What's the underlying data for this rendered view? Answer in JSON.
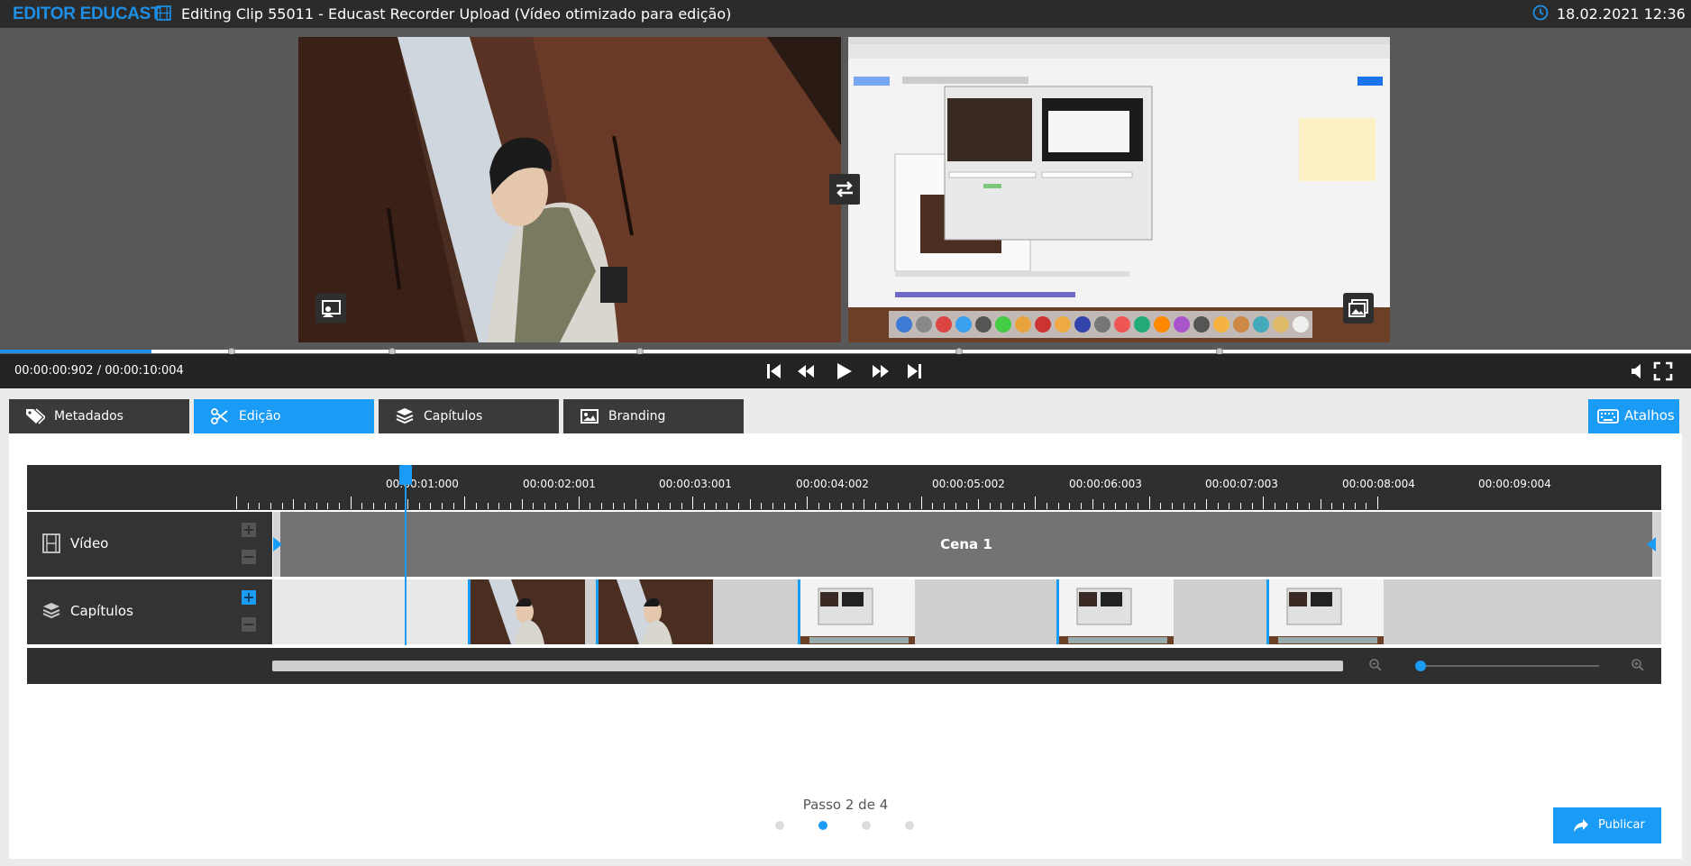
{
  "header": {
    "brand": "EDITOR EDUCAST",
    "clip_title": "Editing Clip 55011 - Educast Recorder Upload  (Vídeo otimizado para edição)",
    "datetime": "18.02.2021 12:36"
  },
  "player": {
    "timecode": "00:00:00:902 / 00:00:10:004",
    "progress_fraction": 0.09
  },
  "tabs": [
    {
      "label": "Metadados",
      "icon": "tag-icon",
      "active": false
    },
    {
      "label": "Edição",
      "icon": "scissors-icon",
      "active": true
    },
    {
      "label": "Capítulos",
      "icon": "layers-icon",
      "active": false
    },
    {
      "label": "Branding",
      "icon": "image-icon",
      "active": false
    }
  ],
  "atalhos_label": "Atalhos",
  "timeline": {
    "ruler_labels": [
      "00:00:01:000",
      "00:00:02:001",
      "00:00:03:001",
      "00:00:04:002",
      "00:00:05:002",
      "00:00:06:003",
      "00:00:07:003",
      "00:00:08:004",
      "00:00:09:004"
    ],
    "tracks": {
      "video": "Vídeo",
      "chapters": "Capítulos"
    },
    "scene_label": "Cena 1"
  },
  "stepper": {
    "text": "Passo 2 de 4",
    "current": 2,
    "total": 4
  },
  "publish_label": "Publicar",
  "colors": {
    "accent": "#1a9bf5",
    "brand": "#1e8fe6"
  }
}
